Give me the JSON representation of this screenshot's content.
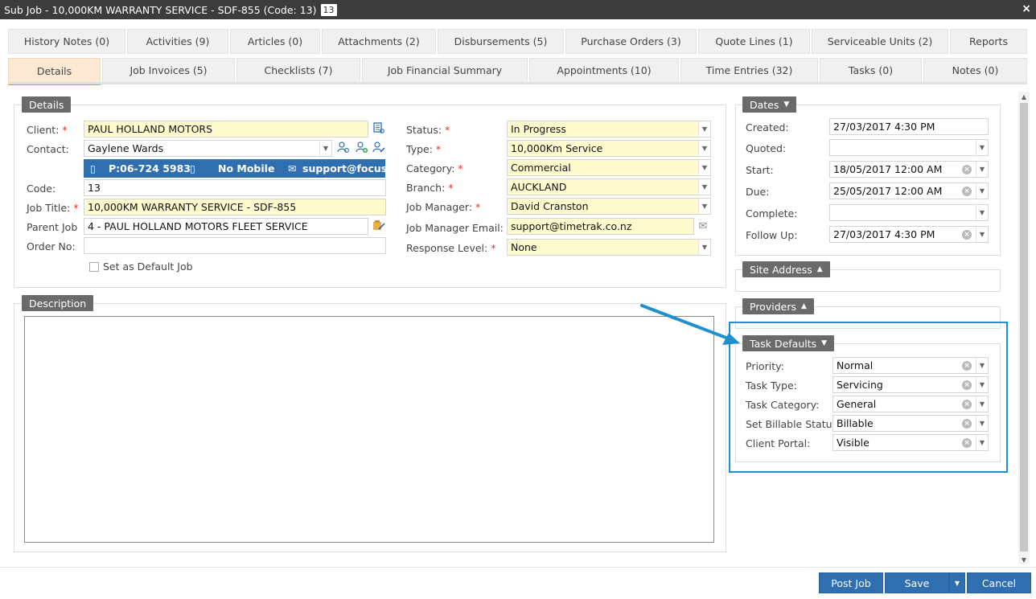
{
  "window": {
    "title": "Sub Job - 10,000KM WARRANTY SERVICE - SDF-855 (Code: 13)",
    "code_badge": "13",
    "close": "×"
  },
  "tabs_row1": [
    "History Notes (0)",
    "Activities (9)",
    "Articles (0)",
    "Attachments (2)",
    "Disbursements (5)",
    "Purchase Orders (3)",
    "Quote Lines (1)",
    "Serviceable Units (2)",
    "Reports"
  ],
  "tabs_row2": [
    "Details",
    "Job Invoices (5)",
    "Checklists (7)",
    "Job Financial Summary",
    "Appointments (10)",
    "Time Entries (32)",
    "Tasks (0)",
    "Notes (0)"
  ],
  "details": {
    "header": "Details",
    "client_label": "Client:",
    "client_value": "PAUL HOLLAND MOTORS",
    "contact_label": "Contact:",
    "contact_value": "Gaylene Wards",
    "phone": "P:06-724 5983",
    "mobile": "No Mobile",
    "email_short": "support@focus...",
    "code_label": "Code:",
    "code_value": "13",
    "jobtitle_label": "Job Title:",
    "jobtitle_value": "10,000KM WARRANTY SERVICE - SDF-855",
    "parentjob_label": "Parent Job",
    "parentjob_value": "4 - PAUL HOLLAND MOTORS FLEET SERVICE",
    "orderno_label": "Order No:",
    "orderno_value": "",
    "default_job_label": "Set as Default Job",
    "status_label": "Status:",
    "status_value": "In Progress",
    "type_label": "Type:",
    "type_value": "10,000Km Service",
    "category_label": "Category:",
    "category_value": "Commercial",
    "branch_label": "Branch:",
    "branch_value": "AUCKLAND",
    "jobmanager_label": "Job Manager:",
    "jobmanager_value": "David Cranston",
    "jmemail_label": "Job Manager Email:",
    "jmemail_value": "support@timetrak.co.nz",
    "response_label": "Response Level:",
    "response_value": "None"
  },
  "description": {
    "header": "Description",
    "value": ""
  },
  "dates": {
    "header": "Dates",
    "created_label": "Created:",
    "created_value": "27/03/2017 4:30 PM",
    "quoted_label": "Quoted:",
    "quoted_value": "",
    "start_label": "Start:",
    "start_value": "18/05/2017 12:00 AM",
    "due_label": "Due:",
    "due_value": "25/05/2017 12:00 AM",
    "complete_label": "Complete:",
    "complete_value": "",
    "followup_label": "Follow Up:",
    "followup_value": "27/03/2017 4:30 PM"
  },
  "site_address": {
    "header": "Site Address"
  },
  "providers": {
    "header": "Providers"
  },
  "task_defaults": {
    "header": "Task Defaults",
    "priority_label": "Priority:",
    "priority_value": "Normal",
    "tasktype_label": "Task Type:",
    "tasktype_value": "Servicing",
    "taskcat_label": "Task Category:",
    "taskcat_value": "General",
    "billable_label": "Set Billable Status:",
    "billable_value": "Billable",
    "portal_label": "Client Portal:",
    "portal_value": "Visible"
  },
  "buttons": {
    "post": "Post Job",
    "save": "Save",
    "cancel": "Cancel"
  },
  "colors": {
    "accent": "#2f6fb0",
    "tab_active": "#f08c2e",
    "highlight": "#1f8fd0",
    "required": "#e0302a",
    "field_yellow": "#fffbcf"
  }
}
